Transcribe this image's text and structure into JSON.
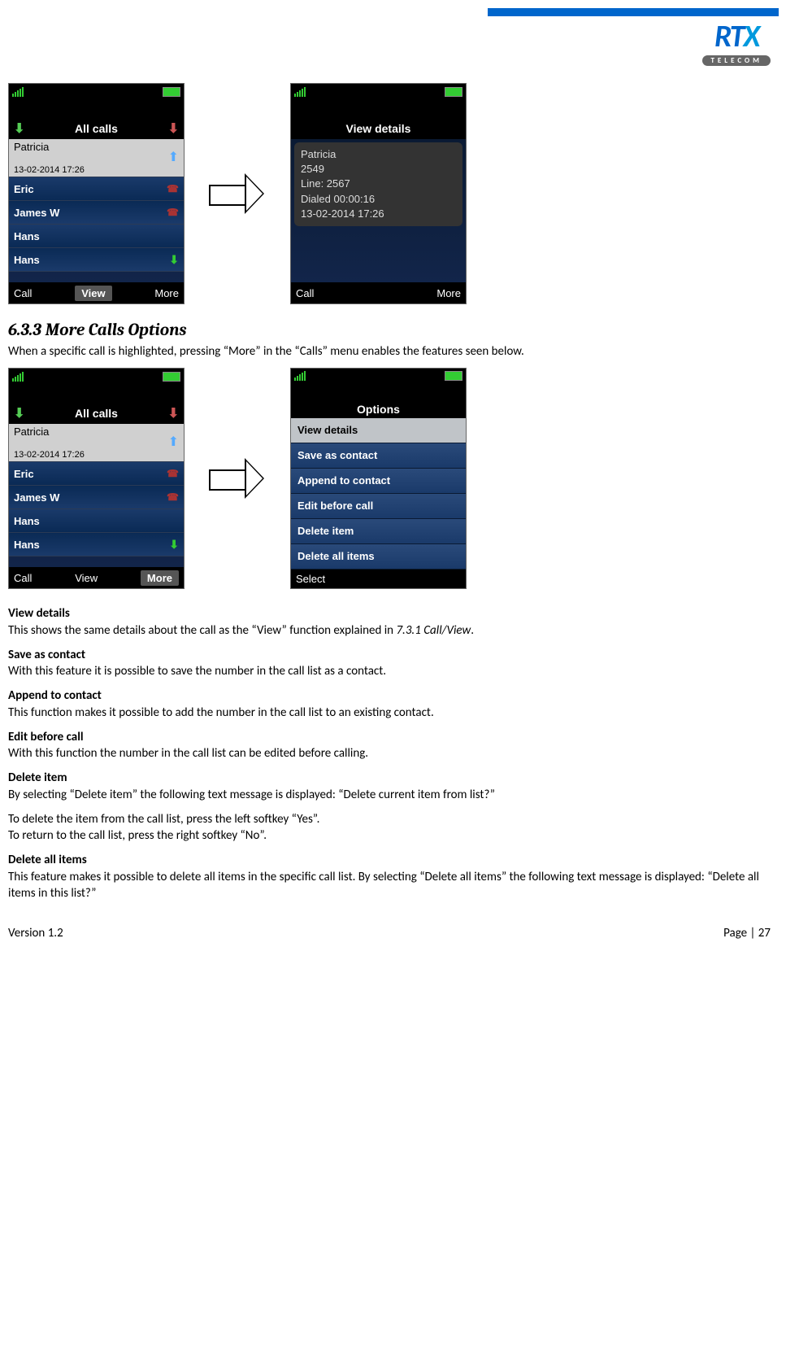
{
  "logo": {
    "main": "RTX",
    "sub": "TELECOM"
  },
  "screens1": {
    "left": {
      "title": "All calls",
      "rows": [
        {
          "name": "Patricia",
          "time": "13-02-2014 17:26",
          "selected": true,
          "icon": "up"
        },
        {
          "name": "Eric",
          "icon": "phone"
        },
        {
          "name": "James W",
          "icon": "phone"
        },
        {
          "name": "Hans",
          "icon": ""
        },
        {
          "name": "Hans",
          "icon": "down"
        }
      ],
      "sk_left": "Call",
      "sk_center": "View",
      "sk_right": "More"
    },
    "right": {
      "title": "View details",
      "lines": [
        "Patricia",
        "2549",
        "Line: 2567",
        "Dialed     00:00:16",
        "13-02-2014 17:26"
      ],
      "sk_left": "Call",
      "sk_right": "More"
    }
  },
  "section_heading": "6.3.3 More Calls Options",
  "section_intro": "When a specific call is highlighted, pressing “More” in the “Calls” menu enables the features seen below.",
  "screens2": {
    "left": {
      "title": "All calls",
      "rows": [
        {
          "name": "Patricia",
          "time": "13-02-2014 17:26",
          "selected": true,
          "icon": "up"
        },
        {
          "name": "Eric",
          "icon": "phone"
        },
        {
          "name": "James W",
          "icon": "phone"
        },
        {
          "name": "Hans",
          "icon": ""
        },
        {
          "name": "Hans",
          "icon": "down"
        }
      ],
      "sk_left": "Call",
      "sk_center_plain": "View",
      "sk_right_boxed": "More"
    },
    "right": {
      "title": "Options",
      "items": [
        "View details",
        "Save as contact",
        "Append to contact",
        "Edit before call",
        "Delete item",
        "Delete all items"
      ],
      "sk_left": "Select"
    }
  },
  "desc": {
    "vd_h": "View details",
    "vd_p": "This shows the same details about the call as the “View” function explained in ",
    "vd_ref": "7.3.1 Call/View",
    "vd_end": ".",
    "sac_h": "Save as contact",
    "sac_p": "With this feature it is possible to save the number in the call list as a contact.",
    "atc_h": "Append to contact",
    "atc_p": "This function makes it possible to add the number in the call list to an existing contact.",
    "ebc_h": "Edit before call",
    "ebc_p": "With this function the number in the call list can be edited before calling.",
    "di_h": "Delete item",
    "di_p1": "By selecting “Delete item” the following text message is displayed: “Delete current item from list?”",
    "di_p2": "To delete the item from the call list, press the left softkey “Yes”.",
    "di_p3": "To return to the call list, press the right softkey “No”.",
    "dai_h": "Delete all items",
    "dai_p": "This feature makes it possible to delete all items in the specific call list. By selecting “Delete all items” the following text message is displayed: “Delete all items in this list?”"
  },
  "footer": {
    "left": "Version 1.2",
    "right": "Page | 27"
  }
}
